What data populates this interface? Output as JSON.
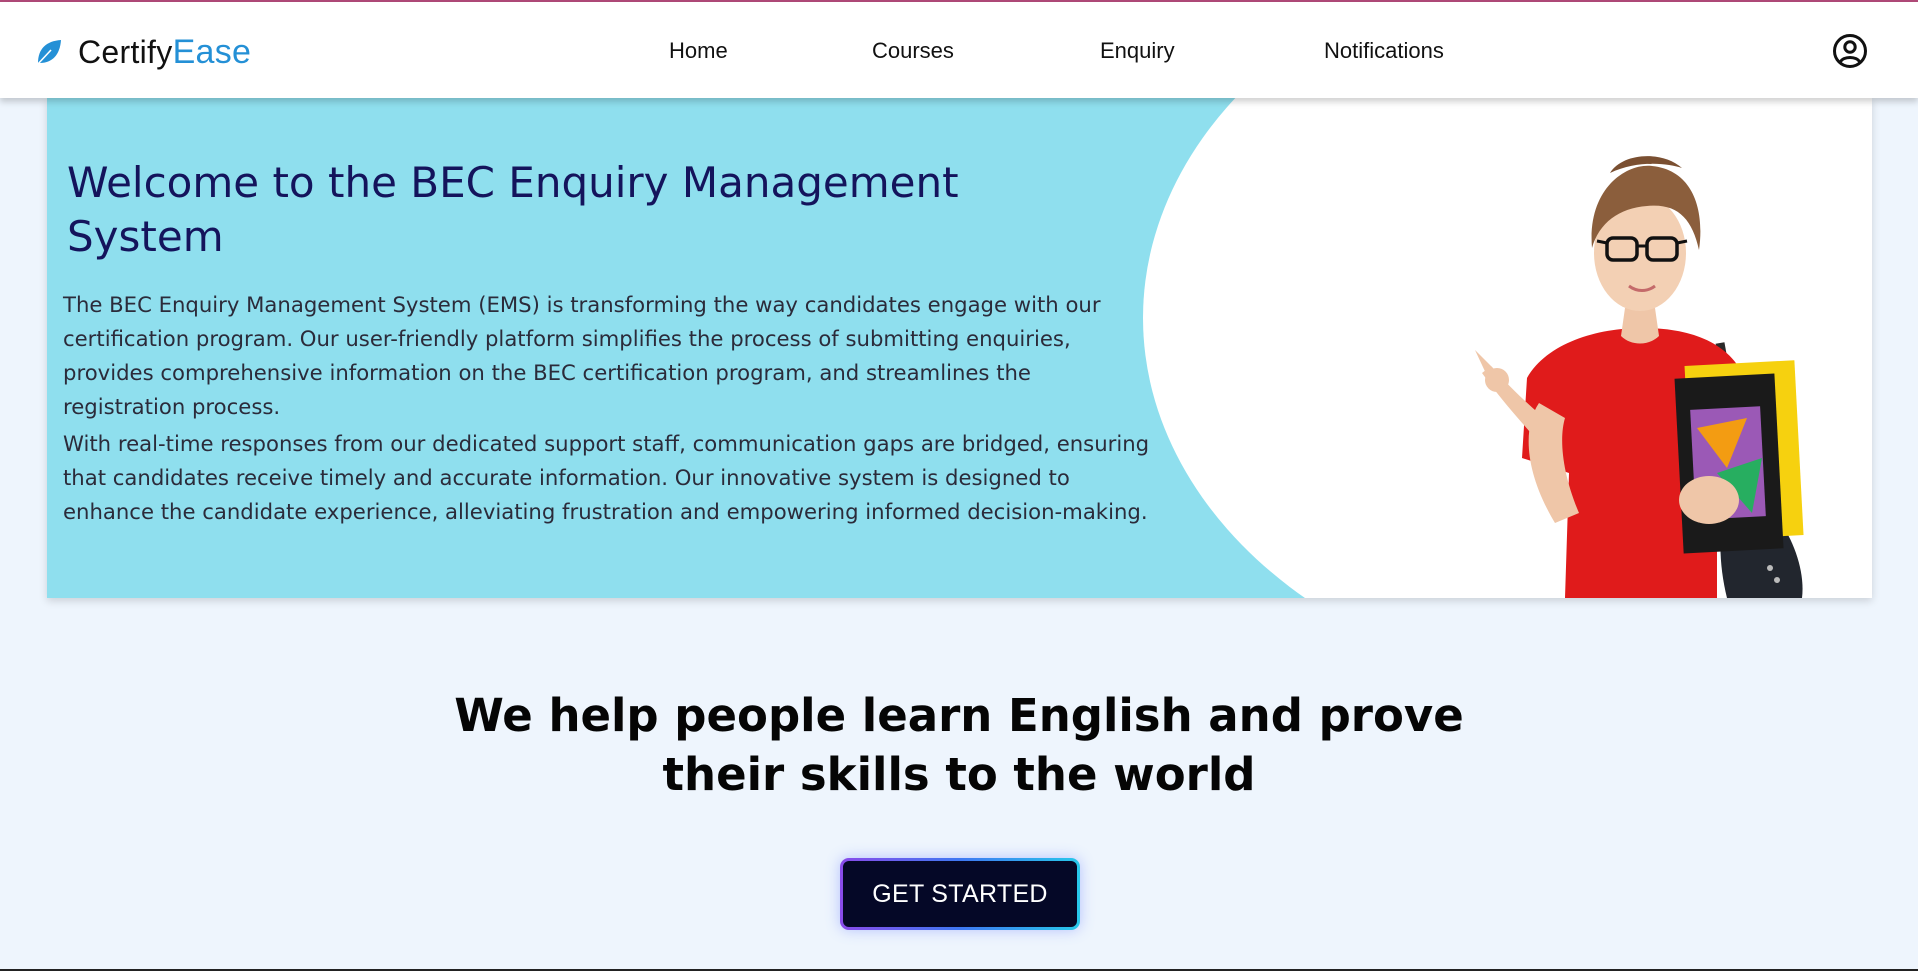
{
  "brand": {
    "name_part1": "Certify",
    "name_part2": "Ease",
    "accent_color": "#2490d6",
    "icon": "leaf-icon"
  },
  "nav": {
    "items": [
      {
        "label": "Home"
      },
      {
        "label": "Courses"
      },
      {
        "label": "Enquiry"
      },
      {
        "label": "Notifications"
      }
    ],
    "profile_icon": "user-circle-icon"
  },
  "hero": {
    "title": "Welcome to the BEC Enquiry Management System",
    "paragraph1": "The BEC Enquiry Management System (EMS) is transforming the way candidates engage with our certification program. Our user-friendly platform simplifies the process of submitting enquiries, provides comprehensive information on the BEC certification program, and streamlines the registration process.",
    "paragraph2": "With real-time responses from our dedicated support staff, communication gaps are bridged, ensuring that candidates receive timely and accurate information. Our innovative system is designed to enhance the candidate experience, alleviating frustration and empowering informed decision-making.",
    "background_color": "#8fdfee",
    "title_color": "#14145c"
  },
  "tagline": {
    "line1": "We help people learn English and prove",
    "line2": "their skills to the world"
  },
  "cta": {
    "label": "GET STARTED"
  }
}
